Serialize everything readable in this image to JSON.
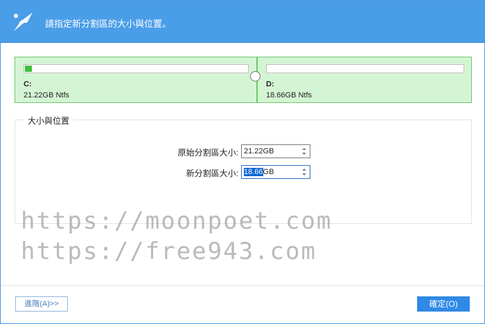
{
  "header": {
    "title": "請指定新分割區的大小與位置。"
  },
  "partitions": [
    {
      "name": "C:",
      "size_text": "21.22GB Ntfs",
      "used_fraction": 0.03
    },
    {
      "name": "D:",
      "size_text": "18.66GB Ntfs",
      "used_fraction": 0.0
    }
  ],
  "group": {
    "title": "大小與位置",
    "original_size": {
      "label": "原始分割區大小:",
      "value": "21.22GB"
    },
    "new_size": {
      "label": "新分割區大小:",
      "value_selected": "18.66",
      "value_unit": "GB"
    }
  },
  "watermark": {
    "line1": "https://moonpoet.com",
    "line2": "https://free943.com"
  },
  "footer": {
    "advanced_label": "進階(A)>>",
    "ok_label": "確定(O)"
  },
  "colors": {
    "header_bg": "#4a9ee8",
    "partition_bg": "#d4f5d4",
    "partition_border": "#6cc96c",
    "used_fill": "#3ec13e",
    "ok_button": "#2e8ae6"
  },
  "icons": {
    "logo": "scissors-logo-icon",
    "spin_up": "arrow-up-icon",
    "spin_down": "arrow-down-icon"
  }
}
